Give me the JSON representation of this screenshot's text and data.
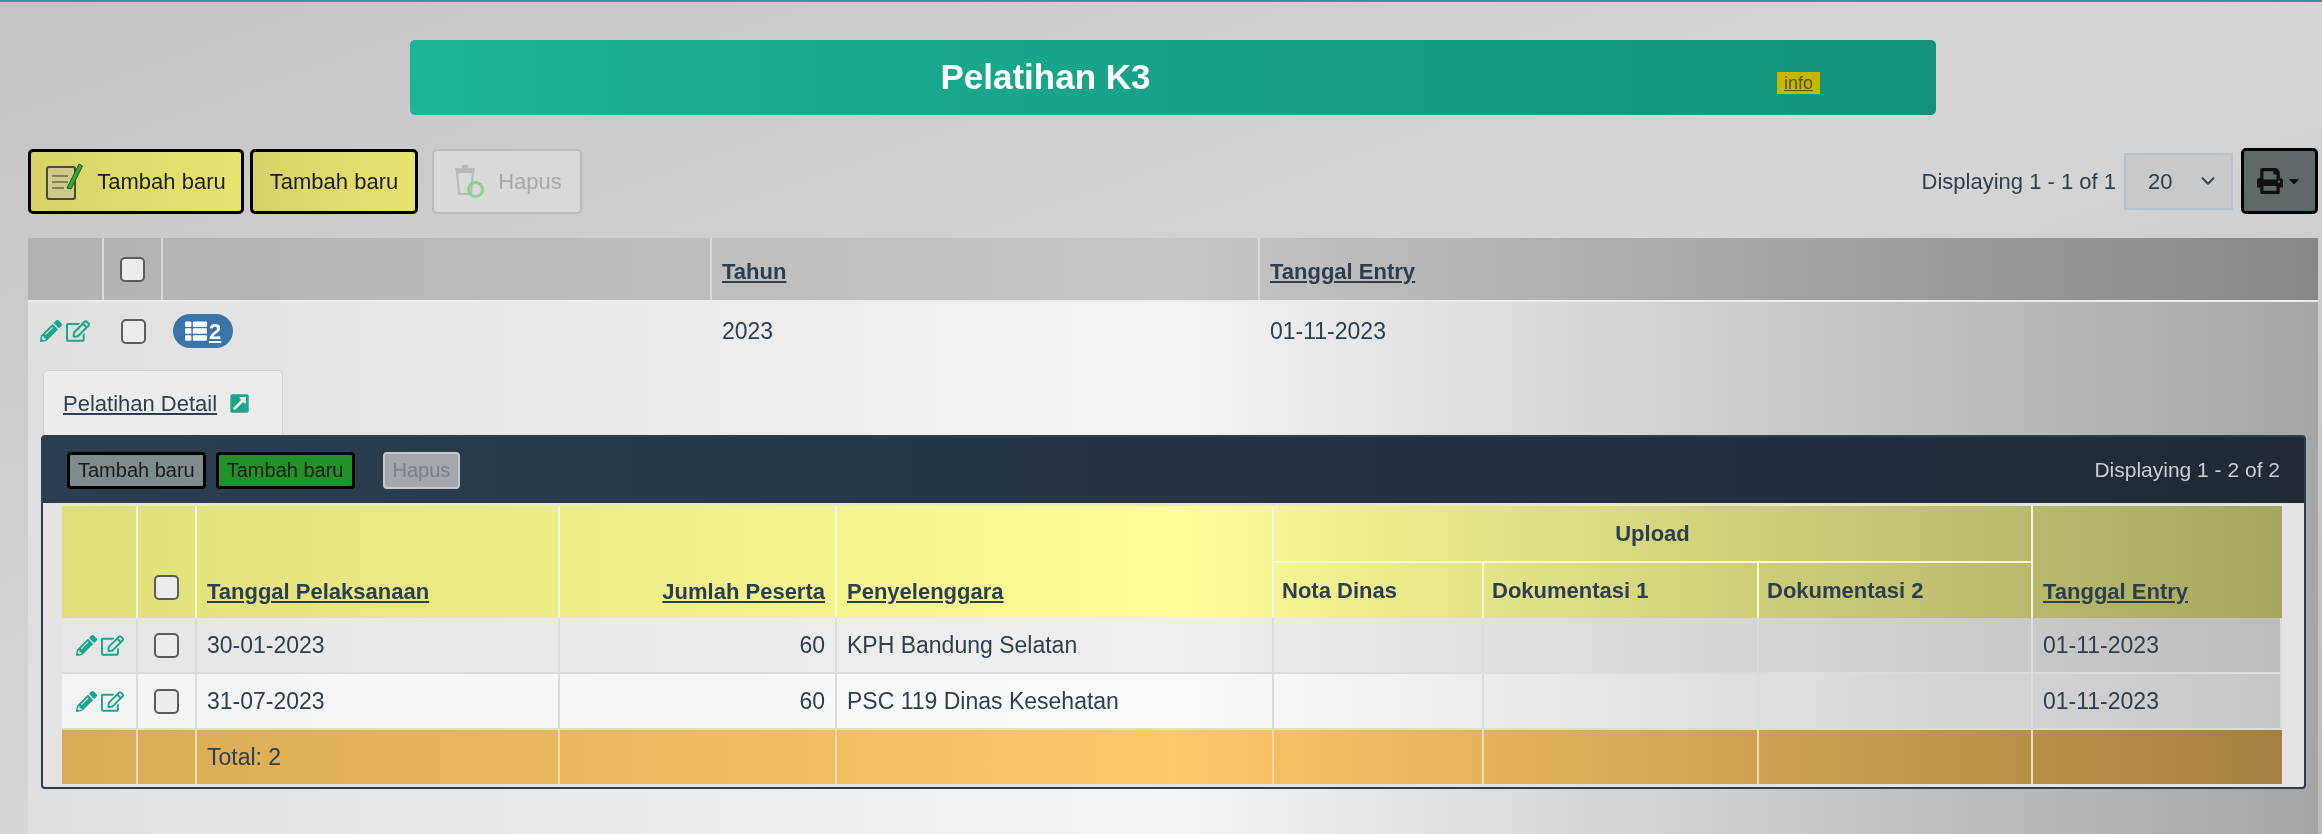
{
  "header": {
    "title": "Pelatihan K3",
    "info_link": "info"
  },
  "toolbar": {
    "buttons": [
      {
        "label": "Tambah baru",
        "kind": "add",
        "disabled": false
      },
      {
        "label": "Tambah baru",
        "kind": "quick",
        "disabled": false
      },
      {
        "label": "Hapus",
        "kind": "delete",
        "disabled": true
      }
    ],
    "paging": "Displaying 1 - 1 of 1",
    "page_size": "20"
  },
  "table": {
    "select_all": {
      "checked": false
    },
    "columns": [
      {
        "label": "Tahun",
        "sortable": true
      },
      {
        "label": "Tanggal Entry",
        "sortable": true
      }
    ],
    "rows": [
      {
        "checked": false,
        "detail_count": "2",
        "expanded": true,
        "cells": [
          "2023",
          "01-11-2023"
        ]
      }
    ]
  },
  "detail": {
    "tabs": [
      {
        "label": "Pelatihan Detail",
        "selected": true
      }
    ],
    "toolbar": {
      "buttons": [
        {
          "label": "Tambah baru",
          "color": "#7f8c8d",
          "disabled": false
        },
        {
          "label": "Tambah baru",
          "color": "#229129",
          "disabled": false
        },
        {
          "label": "Hapus",
          "color": "#a4a7ae",
          "disabled": true
        }
      ],
      "paging": "Displaying 1 - 2 of 2"
    },
    "table": {
      "select_all": {
        "checked": false
      },
      "columns": [
        {
          "label": "Tanggal Pelaksanaan",
          "sortable": true,
          "kind": "text"
        },
        {
          "label": "Jumlah Peserta",
          "sortable": true,
          "kind": "number"
        },
        {
          "label": "Penyelenggara",
          "sortable": true,
          "kind": "text"
        },
        {
          "label": "Upload",
          "children": [
            {
              "label": "Nota Dinas",
              "sortable": false
            },
            {
              "label": "Dokumentasi 1",
              "sortable": false
            },
            {
              "label": "Dokumentasi 2",
              "sortable": false
            }
          ]
        },
        {
          "label": "Tanggal Entry",
          "sortable": true,
          "kind": "text"
        }
      ],
      "rows": [
        {
          "checked": false,
          "cells": [
            "30-01-2023",
            "60",
            "KPH Bandung Selatan",
            null,
            null,
            null,
            "01-11-2023"
          ]
        },
        {
          "checked": false,
          "cells": [
            "31-07-2023",
            "60",
            "PSC 119 Dinas Kesehatan",
            null,
            null,
            null,
            "01-11-2023"
          ]
        }
      ],
      "footer": {
        "label": "Total: 2"
      }
    }
  }
}
